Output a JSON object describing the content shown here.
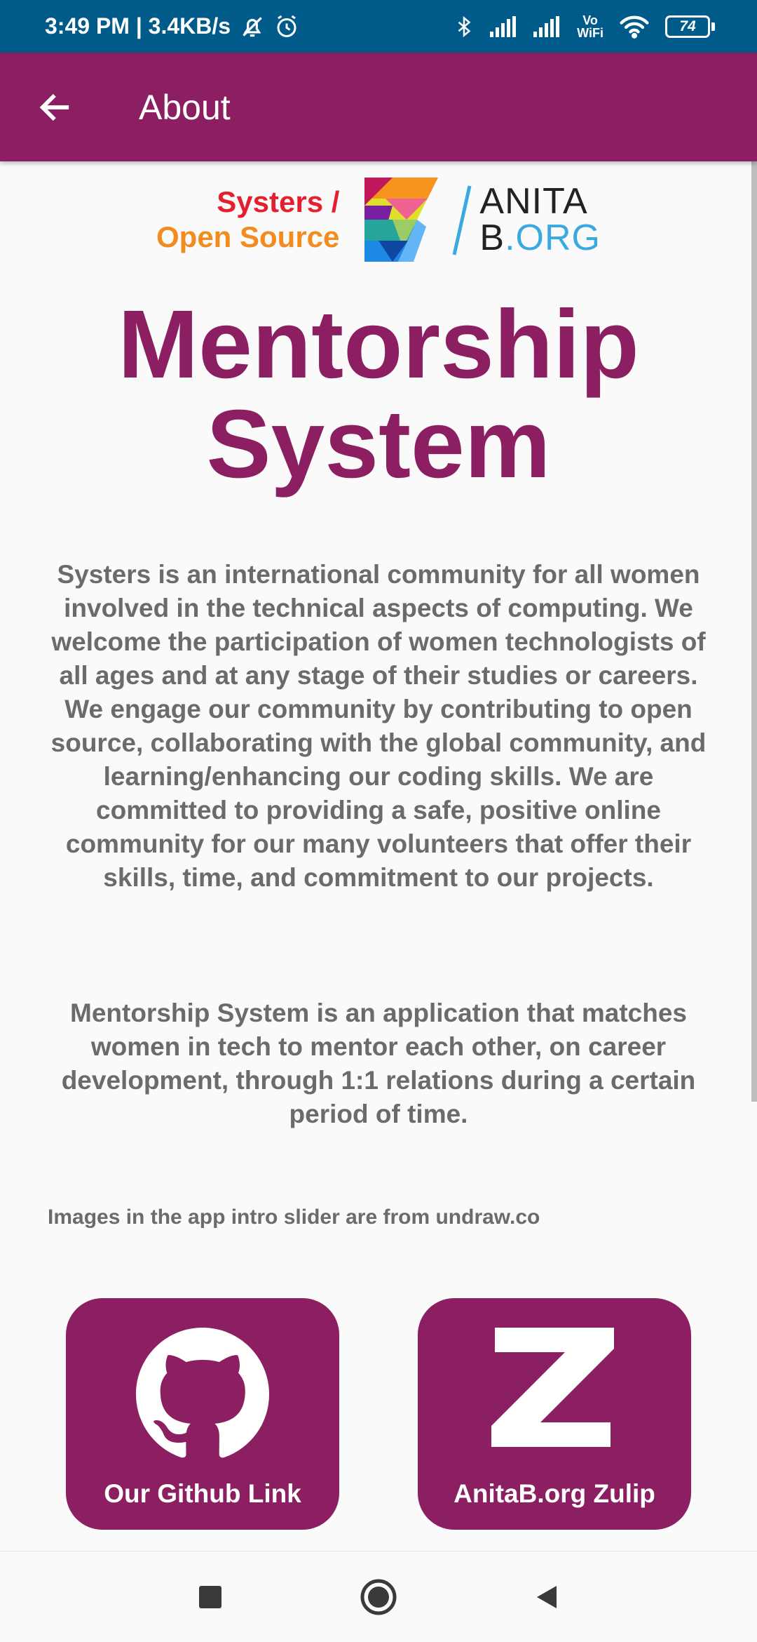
{
  "status_bar": {
    "time_speed": "3:49 PM | 3.4KB/s",
    "wifi_label_top": "Vo",
    "wifi_label_bottom": "WiFi",
    "battery": "74"
  },
  "app_bar": {
    "title": "About"
  },
  "logos": {
    "systers_line1": "Systers /",
    "systers_line2": "Open Source",
    "anita_line1": "ANITA",
    "anita_line2_prefix": "B",
    "anita_line2_accent": ".ORG"
  },
  "main": {
    "title_line1": "Mentorship",
    "title_line2": "System",
    "description": "Systers is an international community for all women involved in the technical aspects of computing. We welcome the participation of women technologists of all ages and at any stage of their studies or careers. We engage our community by contributing to open source, collaborating with the global community, and learning/enhancing our coding skills. We are committed to providing a safe, positive online community for our many volunteers that offer their skills, time, and commitment to our projects.",
    "app_description": "Mentorship System is an application that matches women in tech to mentor each other, on career development, through 1:1 relations during a certain period of time.",
    "credits": "Images in the app intro slider are from undraw.co"
  },
  "links": {
    "github_label": "Our Github Link",
    "zulip_label": "AnitaB.org Zulip"
  },
  "colors": {
    "brand": "#8c1f62",
    "status_bar": "#005a8a",
    "body_text": "#6b6b6b"
  },
  "icons": {
    "back": "arrow-back-icon",
    "github": "github-icon",
    "zulip": "zulip-icon",
    "nav_recents": "square-icon",
    "nav_home": "circle-icon",
    "nav_back": "triangle-back-icon"
  }
}
